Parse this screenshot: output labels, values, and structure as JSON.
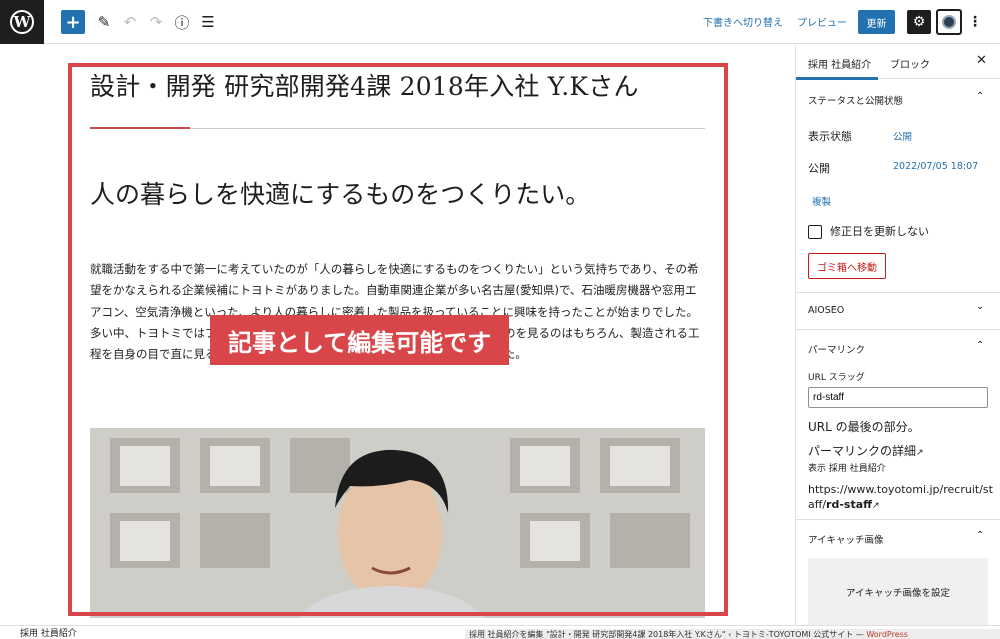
{
  "toolbar": {
    "logo": "W",
    "add_icon": "+",
    "pen_icon": "✎",
    "undo_icon": "↶",
    "redo_icon": "↷",
    "info_icon": "ⓘ",
    "list_icon": "☰",
    "switch_draft": "下書きへ切り替え",
    "preview": "プレビュー",
    "update": "更新",
    "settings_icon": "⚙",
    "more_icon": "⋮"
  },
  "post": {
    "title": "設計・開発 研究部開発4課 2018年入社 Y.Kさん",
    "heading": "人の暮らしを快適にするものをつくりたい。",
    "body": "就職活動をする中で第一に考えていたのが「人の暮らしを快適にするものをつくりたい」という気持ちであり、その希望をかなえられる企業候補にトヨトミがありました。自動車関連企業が多い名古屋(愛知県)で、石油暖房機器や窓用エアコン、空気清浄機といった、より人の暮らしに密着した製品を扱っていることに興味を持ったことが始まりでした。多い中、トヨトミではプレス加工や溶接の前工程から、品の完成形を市場で並ぶのを見るのはもちろん、製造される工程を自身の目で直に見ることができるという魅力にひかれトヨトミに入社しました。"
  },
  "overlay": {
    "label": "記事として編集可能です"
  },
  "sidebar": {
    "tab_post": "採用 社員紹介",
    "tab_block": "ブロック",
    "close_icon": "✕",
    "status_panel": "ステータスと公開状態",
    "visibility_label": "表示状態",
    "visibility_value": "公開",
    "publish_label": "公開",
    "publish_value": "2022/07/05 18:07",
    "duplicate": "複製",
    "no_modified_label": "修正日を更新しない",
    "trash": "ゴミ箱へ移動",
    "aioseo": "AIOSEO",
    "permalink_panel": "パーマリンク",
    "url_slug_label": "URL スラッグ",
    "url_slug_value": "rd-staff",
    "url_last_part": "URL の最後の部分。",
    "permalink_details": "パーマリンクの詳細",
    "view_label": "表示 採用 社員紹介",
    "url_prefix": "https://www.toyotomi.jp/recruit/staff/",
    "url_slug_bold": "rd-staff",
    "featured_panel": "アイキャッチ画像",
    "featured_button": "アイキャッチ画像を設定",
    "chevron_up": "⌃",
    "chevron_down": "⌄",
    "external_icon": "↗"
  },
  "statusbar": {
    "breadcrumb": "採用 社員紹介",
    "browser_title": "採用 社員紹介を編集 \"設計・開発 研究部開発4課 2018年入社 Y.Kさん\" ‹ トヨトミ-TOYOTOMI 公式サイト — ",
    "browser_title_wp": "WordPress"
  }
}
